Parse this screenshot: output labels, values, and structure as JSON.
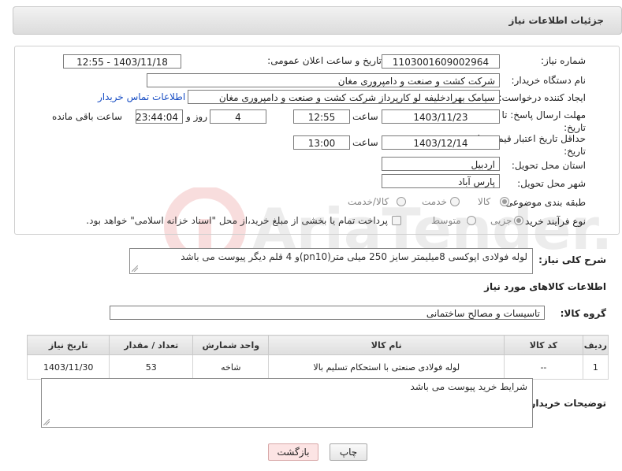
{
  "header": {
    "title": "جزئیات اطلاعات نیاز"
  },
  "form": {
    "need_number": {
      "label": "شماره نیاز:",
      "value": "1103001609002964"
    },
    "announce": {
      "label": "تاریخ و ساعت اعلان عمومی:",
      "value": "1403/11/18 - 12:55"
    },
    "buyer": {
      "label": "نام دستگاه خریدار:",
      "value": "شرکت کشت و صنعت و دامپروری مغان"
    },
    "creator": {
      "label": "ایجاد کننده درخواست:",
      "value": "سیامک بهرادخلیفه لو کارپرداز شرکت کشت و صنعت و دامپروری مغان",
      "contact_link": "اطلاعات تماس خریدار"
    },
    "deadline": {
      "label": "مهلت ارسال پاسخ: تا تاریخ:",
      "date": "1403/11/23",
      "time_label": "ساعت",
      "time": "12:55",
      "days": "4",
      "days_label": "روز و",
      "remaining": "23:44:04",
      "remaining_label": "ساعت باقی مانده"
    },
    "validity": {
      "label": "حداقل تاریخ اعتبار قیمت: تا تاریخ:",
      "date": "1403/12/14",
      "time_label": "ساعت",
      "time": "13:00"
    },
    "province": {
      "label": "استان محل تحویل:",
      "value": "اردبیل"
    },
    "city": {
      "label": "شهر محل تحویل:",
      "value": "پارس آباد"
    },
    "category": {
      "label": "طبقه بندی موضوعی:",
      "options": [
        "کالا",
        "خدمت",
        "کالا/خدمت"
      ],
      "selected": "کالا"
    },
    "process": {
      "label": "نوع فرآیند خرید :",
      "options": [
        "جزیی",
        "متوسط"
      ],
      "selected": "جزیی",
      "note": "پرداخت تمام یا بخشی از مبلغ خرید،از محل \"اسناد خزانه اسلامی\" خواهد بود."
    }
  },
  "description": {
    "label": "شرح کلی نیاز:",
    "value": "لوله فولادی اپوکسی 8میلیمتر سایز 250 میلی متر(pn10)و 4 قلم دیگر پیوست می باشد"
  },
  "goods_section": {
    "title": "اطلاعات کالاهای مورد نیاز"
  },
  "goods_group": {
    "label": "گروه کالا:",
    "value": "تاسیسات و مصالح ساختمانی"
  },
  "table": {
    "headers": [
      "ردیف",
      "کد کالا",
      "نام کالا",
      "واحد شمارش",
      "تعداد / مقدار",
      "تاریخ نیاز"
    ],
    "rows": [
      [
        "1",
        "--",
        "لوله فولادی صنعتی با استحکام تسلیم بالا",
        "شاخه",
        "53",
        "1403/11/30"
      ]
    ]
  },
  "buyer_notes": {
    "label": "توضیحات خریدار:",
    "value": "شرایط خرید پیوست می باشد"
  },
  "buttons": {
    "print": "چاپ",
    "back": "بازگشت"
  }
}
